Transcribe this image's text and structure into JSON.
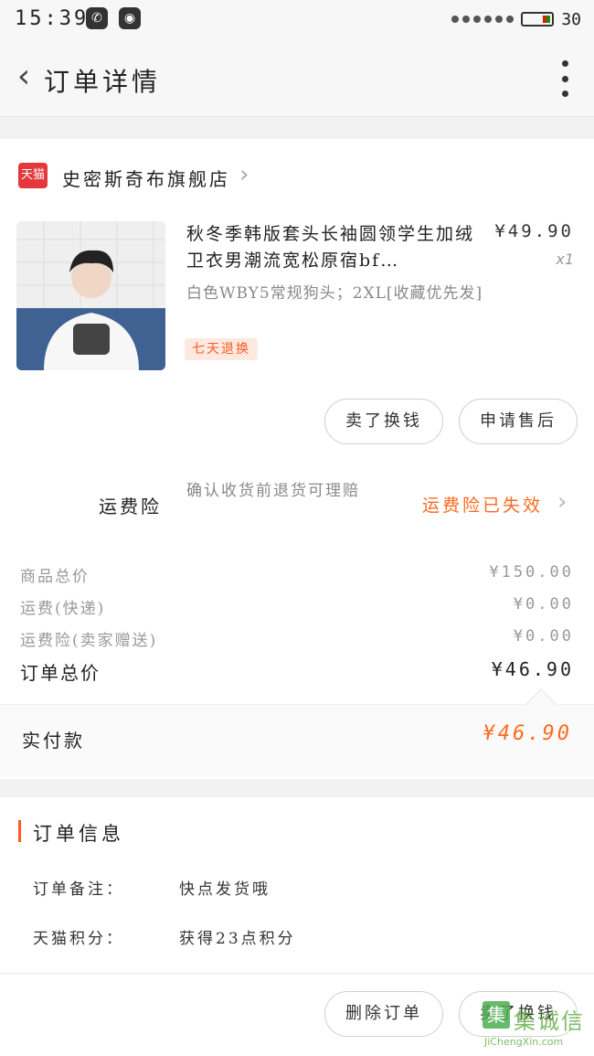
{
  "status_bar": {
    "time": "15:39",
    "battery": "30",
    "icons": [
      "wechat-icon",
      "qq-icon",
      "battery-icon"
    ]
  },
  "header": {
    "title": "订单详情"
  },
  "shop": {
    "badge": "天猫",
    "name": "史密斯奇布旗舰店"
  },
  "item": {
    "title": "秋冬季韩版套头长袖圆领学生加绒卫衣男潮流宽松原宿bf…",
    "price": "¥49.90",
    "quantity": "x1",
    "spec": "白色WBY5常规狗头；2XL[收藏优先发]",
    "tag": "七天退换"
  },
  "item_actions": {
    "refund_label": "卖了换钱",
    "aftersale_label": "申请售后"
  },
  "insurance": {
    "label": "运费险",
    "description": "确认收货前退货可理赔",
    "status": "运费险已失效"
  },
  "prices": {
    "goods_total_label": "商品总价",
    "goods_total_value": "¥150.00",
    "shipping_label": "运费(快递)",
    "shipping_value": "¥0.00",
    "insurance_label": "运费险(卖家赠送)",
    "insurance_value": "¥0.00",
    "order_total_label": "订单总价",
    "order_total_value": "¥46.90"
  },
  "payment": {
    "label": "实付款",
    "value": "¥46.90"
  },
  "order_info": {
    "title": "订单信息",
    "rows": [
      {
        "label": "订单备注：",
        "value": "快点发货哦"
      },
      {
        "label": "天猫积分：",
        "value": "获得23点积分"
      }
    ]
  },
  "bottom_actions": {
    "delete_label": "删除订单",
    "refund_label": "卖了换钱"
  },
  "watermark": {
    "text": "集诚信",
    "mark": "集",
    "url": "JiChengXin.com"
  },
  "colors": {
    "accent": "#ff6a1e",
    "tmall_red": "#e4393c"
  }
}
